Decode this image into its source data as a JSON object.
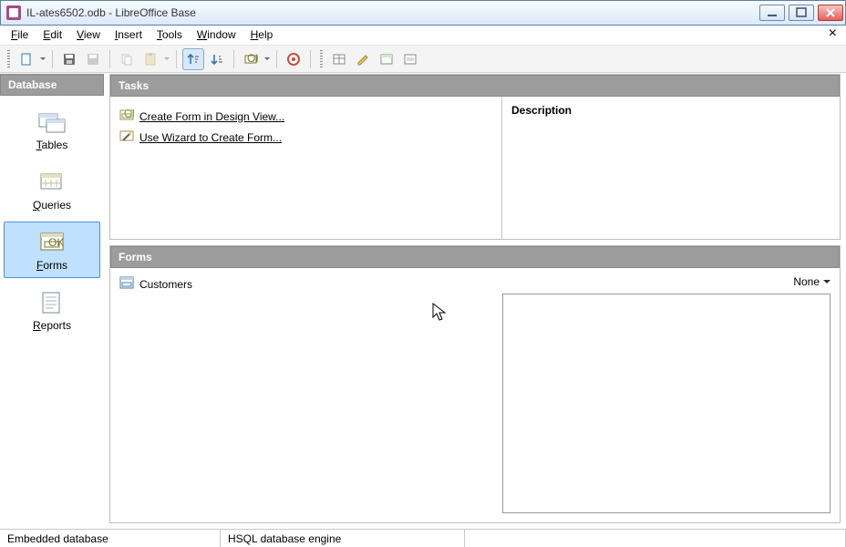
{
  "window": {
    "title": "IL-ates6502.odb - LibreOffice Base"
  },
  "menus": {
    "file": "File",
    "edit": "Edit",
    "view": "View",
    "insert": "Insert",
    "tools": "Tools",
    "window": "Window",
    "help": "Help"
  },
  "sidebar": {
    "header": "Database",
    "tables": "Tables",
    "queries": "Queries",
    "forms": "Forms",
    "reports": "Reports",
    "selected": "forms"
  },
  "panes": {
    "tasks_header": "Tasks",
    "forms_header": "Forms",
    "description_label": "Description"
  },
  "tasks": {
    "create_form_design": "Create Form in Design View...",
    "use_wizard": "Use Wizard to Create Form..."
  },
  "forms": {
    "items": [
      {
        "name": "Customers"
      }
    ],
    "preview_mode": "None"
  },
  "statusbar": {
    "embedded": "Embedded database",
    "engine": "HSQL database engine"
  }
}
